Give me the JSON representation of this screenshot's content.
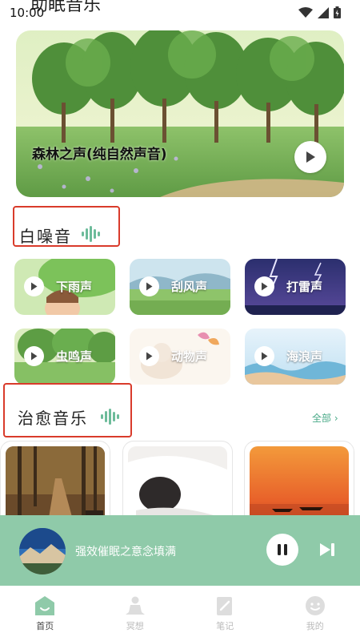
{
  "status_bar": {
    "time": "10:00",
    "partial_title": "助眠音乐"
  },
  "hero": {
    "title": "森林之声(纯自然声音)"
  },
  "white_noise": {
    "title": "白噪音",
    "items": [
      {
        "label": "下雨声"
      },
      {
        "label": "刮风声"
      },
      {
        "label": "打雷声"
      },
      {
        "label": "虫鸣声"
      },
      {
        "label": "动物声"
      },
      {
        "label": "海浪声"
      }
    ]
  },
  "healing_music": {
    "title": "治愈音乐",
    "all_label": "全部"
  },
  "player": {
    "title": "强效催眠之意念填满"
  },
  "nav": {
    "items": [
      {
        "label": "首页",
        "icon": "home-icon"
      },
      {
        "label": "冥想",
        "icon": "meditation-icon"
      },
      {
        "label": "笔记",
        "icon": "note-icon"
      },
      {
        "label": "我的",
        "icon": "profile-icon"
      }
    ]
  },
  "colors": {
    "accent": "#8fcaa9",
    "highlight_box": "#d93b2b",
    "link": "#4aaa88"
  }
}
